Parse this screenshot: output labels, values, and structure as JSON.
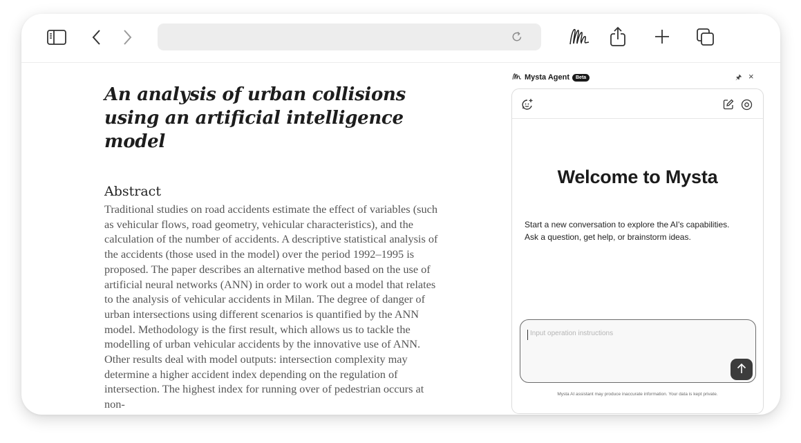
{
  "browser": {
    "address_value": "",
    "icons": [
      "sidebar-toggle-icon",
      "back-icon",
      "forward-icon",
      "reload-icon",
      "mysta-logo-icon",
      "share-icon",
      "new-tab-icon",
      "tabs-overview-icon"
    ]
  },
  "article": {
    "title": "An analysis of urban collisions using an artificial intelligence model",
    "abstract_heading": "Abstract",
    "abstract_text": "Traditional studies on road accidents estimate the effect of variables (such as vehicular flows, road geometry, vehicular characteristics), and the calculation of the number of accidents. A descriptive statistical analysis of the accidents (those used in the model) over the period 1992–1995 is proposed. The paper describes an alternative method based on the use of artificial neural networks (ANN) in order to work out a model that relates to the analysis of vehicular accidents in Milan. The degree of danger of urban intersections using different scenarios is quantified by the ANN model. Methodology is the first result, which allows us to tackle the modelling of urban vehicular accidents by the innovative use of ANN. Other results deal with model outputs: intersection complexity may determine a higher accident index depending on the regulation of intersection. The highest index for running over of pedestrian occurs at non-"
  },
  "agent": {
    "name": "Mysta Agent",
    "badge": "Beta",
    "pin_symbol": "🖈",
    "close_symbol": "×",
    "welcome_title": "Welcome to Mysta",
    "intro_line1": "Start a new conversation to explore the AI's capabilities.",
    "intro_line2": "Ask a question, get help, or brainstorm ideas.",
    "input_value": "",
    "input_placeholder": "Input operation instructions",
    "disclaimer": "Mysta AI assistant may produce inaccurate information. Your data is kept private."
  },
  "colors": {
    "accent_dark": "#3c3c3c",
    "text_primary": "#1b1b1b",
    "text_body": "#555555",
    "address_bar": "#ededed"
  }
}
